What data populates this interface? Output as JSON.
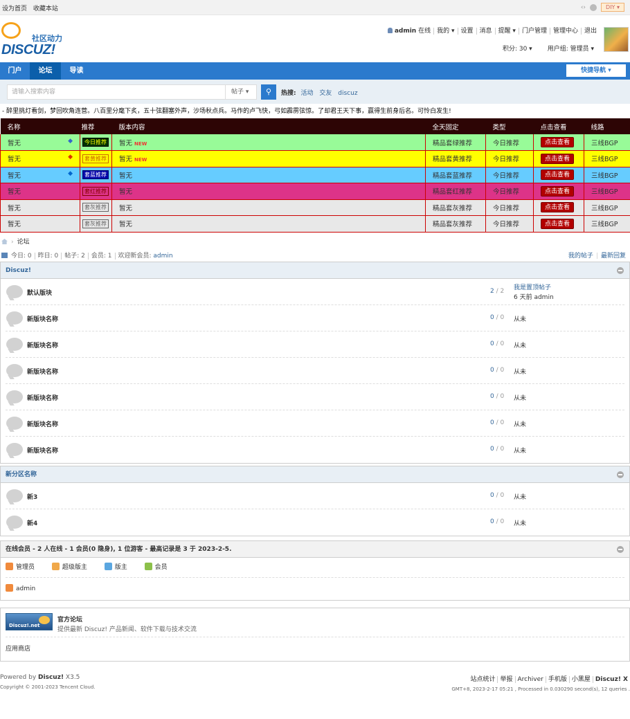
{
  "topbar": {
    "set_home": "设为首页",
    "bookmark": "收藏本站",
    "diy": "DIY"
  },
  "logo": {
    "tagline": "社区动力",
    "wordmark": "DISCUZ!"
  },
  "user": {
    "name": "admin",
    "online": "在线",
    "my": "我的",
    "settings": "设置",
    "messages": "消息",
    "remind": "提醒",
    "portal_admin": "门户管理",
    "admin_center": "管理中心",
    "logout": "退出",
    "credits": "积分: 30",
    "usergroup": "用户组: 管理员"
  },
  "nav": {
    "items": [
      "门户",
      "论坛",
      "导读"
    ],
    "quick": "快捷导航"
  },
  "search": {
    "placeholder": "请输入搜索内容",
    "type": "帖子",
    "hot_label": "热搜:",
    "hot": [
      "活动",
      "交友",
      "discuz"
    ]
  },
  "notice": "- 醉里挑灯看剑，梦回吹角连营。八百里分麾下炙，五十弦翻塞外声，沙场秋点兵。马作的卢飞快，弓如霹雳弦惊。了却君王天下事，赢得生前身后名。可怜白发生!",
  "promo": {
    "headers": [
      "名称",
      "推荐",
      "版本内容",
      "全天固定",
      "类型",
      "点击查看",
      "线路"
    ],
    "rows": [
      {
        "name": "暂无",
        "badge": "今日推荐",
        "content": "暂无",
        "fixed": "精品套绿推荐",
        "type": "今日推荐",
        "view": "点击查看",
        "line": "三线BGP",
        "bg": "#98fb98",
        "badge_bg": "#003300",
        "badge_fg": "#ffff00",
        "badge_border": "#000000",
        "icon_color": "#3366cc",
        "new": "NEW"
      },
      {
        "name": "暂无",
        "badge": "套黄推荐",
        "content": "暂无",
        "fixed": "精品套黄推荐",
        "type": "今日推荐",
        "view": "点击查看",
        "line": "三线BGP",
        "bg": "#ffff00",
        "badge_bg": "#ffff00",
        "badge_fg": "#cc6600",
        "badge_border": "#cc6600",
        "icon_color": "#dd3300",
        "new": "NEW"
      },
      {
        "name": "暂无",
        "badge": "套蓝推荐",
        "content": "暂无",
        "fixed": "精品套蓝推荐",
        "type": "今日推荐",
        "view": "点击查看",
        "line": "三线BGP",
        "bg": "#66ccff",
        "badge_bg": "#0000aa",
        "badge_fg": "#ffffff",
        "badge_border": "#000066",
        "icon_color": "#0066cc",
        "new": ""
      },
      {
        "name": "暂无",
        "badge": "套红推荐",
        "content": "暂无",
        "fixed": "精品套红推荐",
        "type": "今日推荐",
        "view": "点击查看",
        "line": "三线BGP",
        "bg": "#dd3388",
        "badge_bg": "#dd3388",
        "badge_fg": "#880000",
        "badge_border": "#880000",
        "icon_color": "",
        "new": ""
      },
      {
        "name": "暂无",
        "badge": "套灰推荐",
        "content": "暂无",
        "fixed": "精品套灰推荐",
        "type": "今日推荐",
        "view": "点击查看",
        "line": "三线BGP",
        "bg": "#e8e8e8",
        "badge_bg": "#e8e8e8",
        "badge_fg": "#666666",
        "badge_border": "#666666",
        "icon_color": "",
        "new": ""
      },
      {
        "name": "暂无",
        "badge": "套灰推荐",
        "content": "暂无",
        "fixed": "精品套灰推荐",
        "type": "今日推荐",
        "view": "点击查看",
        "line": "三线BGP",
        "bg": "#e8e8e8",
        "badge_bg": "#e8e8e8",
        "badge_fg": "#666666",
        "badge_border": "#666666",
        "icon_color": "",
        "new": ""
      }
    ]
  },
  "breadcrumb": {
    "current": "论坛"
  },
  "stats": {
    "today": "今日: 0",
    "yesterday": "昨日: 0",
    "posts": "帖子: 2",
    "members": "会员: 1",
    "welcome": "欢迎新会员:",
    "newest": "admin",
    "my_posts": "我的帖子",
    "latest": "最新回复"
  },
  "categories": [
    {
      "title": "Discuz!",
      "forums": [
        {
          "name": "默认版块",
          "threads": "2",
          "posts": "2",
          "last_title": "我是置顶帖子",
          "last_meta": "6 天前 admin"
        },
        {
          "name": "新版块名称",
          "threads": "0",
          "posts": "0",
          "last_title": "",
          "last_meta": "从未"
        },
        {
          "name": "新版块名称",
          "threads": "0",
          "posts": "0",
          "last_title": "",
          "last_meta": "从未"
        },
        {
          "name": "新版块名称",
          "threads": "0",
          "posts": "0",
          "last_title": "",
          "last_meta": "从未"
        },
        {
          "name": "新版块名称",
          "threads": "0",
          "posts": "0",
          "last_title": "",
          "last_meta": "从未"
        },
        {
          "name": "新版块名称",
          "threads": "0",
          "posts": "0",
          "last_title": "",
          "last_meta": "从未"
        },
        {
          "name": "新版块名称",
          "threads": "0",
          "posts": "0",
          "last_title": "",
          "last_meta": "从未"
        }
      ]
    },
    {
      "title": "新分区名称",
      "forums": [
        {
          "name": "新3",
          "threads": "0",
          "posts": "0",
          "last_title": "",
          "last_meta": "从未"
        },
        {
          "name": "新4",
          "threads": "0",
          "posts": "0",
          "last_title": "",
          "last_meta": "从未"
        }
      ]
    }
  ],
  "online": {
    "title": "在线会员 - 2 人在线 - 1 会员(0 隐身), 1 位游客 - 最高记录是 3 于 2023-2-5.",
    "legend": [
      {
        "label": "管理员",
        "color": "#f08a3c"
      },
      {
        "label": "超级版主",
        "color": "#f0a84a"
      },
      {
        "label": "版主",
        "color": "#5aa6e0"
      },
      {
        "label": "会员",
        "color": "#8cc04a"
      }
    ],
    "users": [
      "admin"
    ]
  },
  "links": {
    "logo_text": "Discuz!.net",
    "title": "官方论坛",
    "desc": "提供最新 Discuz! 产品新闻、软件下载与技术交流",
    "store": "应用商店"
  },
  "footer": {
    "powered": "Powered by",
    "brand": "Discuz!",
    "version": "X3.5",
    "copyright": "Copyright © 2001-2023 Tencent Cloud.",
    "links": [
      "站点统计",
      "举报",
      "Archiver",
      "手机版",
      "小黑屋",
      "Discuz! X"
    ],
    "meta": "GMT+8, 2023-2-17 05:21 , Processed in 0.030290 second(s), 12 queries ."
  }
}
